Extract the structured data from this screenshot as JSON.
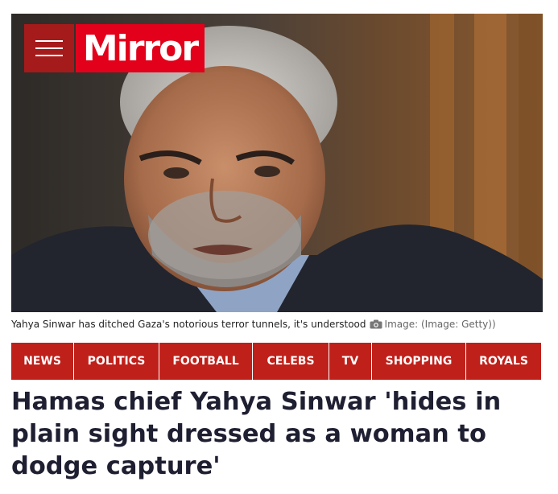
{
  "brand": {
    "name": "Mirror"
  },
  "image": {
    "caption": "Yahya Sinwar has ditched Gaza's notorious terror tunnels, it's understood",
    "credit": "Image: (Image: Getty))"
  },
  "nav": {
    "items": [
      "NEWS",
      "POLITICS",
      "FOOTBALL",
      "CELEBS",
      "TV",
      "SHOPPING",
      "ROYALS"
    ]
  },
  "article": {
    "headline": "Hamas chief Yahya Sinwar 'hides in plain sight dressed as a woman to dodge capture'"
  },
  "colors": {
    "brand_red": "#e2001a",
    "menu_red": "#a51b1b",
    "nav_red": "#c0201a",
    "headline": "#1f1f32"
  },
  "icons": {
    "menu": "hamburger-icon",
    "camera": "camera-icon"
  }
}
